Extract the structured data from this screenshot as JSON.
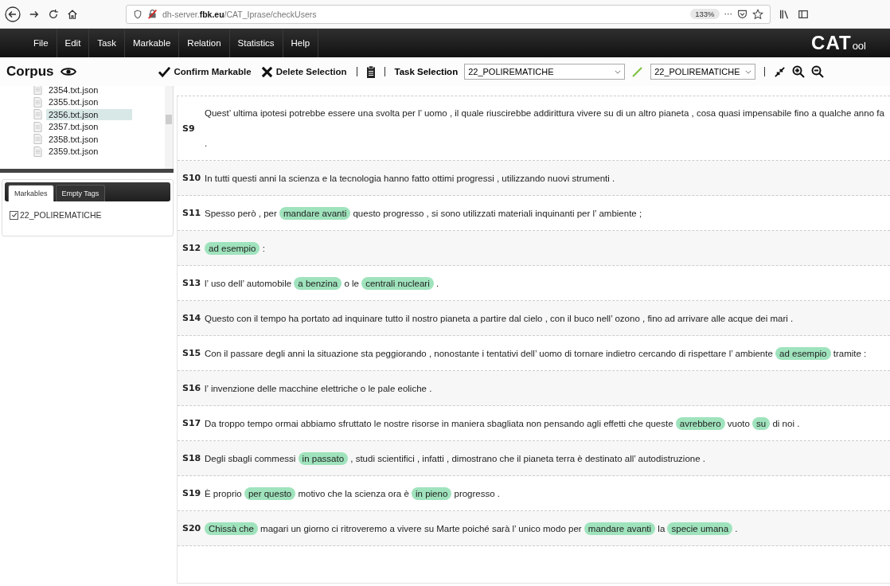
{
  "browser": {
    "url": "dh-server.**fbk.eu**/CAT_Iprase/checkUsers",
    "zoom": "133%",
    "more": "···"
  },
  "menu": [
    "File",
    "Edit",
    "Task",
    "Markable",
    "Relation",
    "Statistics",
    "Help"
  ],
  "logo": {
    "main": "CAT",
    "suffix": "ool"
  },
  "toolbar": {
    "corpus": "Corpus",
    "confirm": "Confirm Markable",
    "delete": "Delete Selection",
    "task_label": "Task Selection",
    "task_value": "22_POLIREMATICHE",
    "tag_value": "22_POLIREMATICHE"
  },
  "files": [
    {
      "name": "2354.txt.json",
      "selected": false
    },
    {
      "name": "2355.txt.json",
      "selected": false
    },
    {
      "name": "2356.txt.json",
      "selected": true
    },
    {
      "name": "2357.txt.json",
      "selected": false
    },
    {
      "name": "2358.txt.json",
      "selected": false
    },
    {
      "name": "2359.txt.json",
      "selected": false
    }
  ],
  "tabs": [
    {
      "label": "Markables",
      "selected": true
    },
    {
      "label": "Empty Tags",
      "selected": false
    }
  ],
  "markables": [
    {
      "label": "22_POLIREMATICHE",
      "checked": true
    }
  ],
  "sentences": [
    {
      "id": "S9",
      "segments": [
        {
          "text": "Quest’ ultima ipotesi potrebbe essere una svolta per l’ uomo , il quale riuscirebbe addirittura vivere su di un altro pianeta , cosa quasi impensabile fino a qualche anno fa .",
          "marked": false
        }
      ]
    },
    {
      "id": "S10",
      "segments": [
        {
          "text": "In tutti questi anni la scienza e la tecnologia hanno fatto ottimi progressi , utilizzando nuovi strumenti .",
          "marked": false
        }
      ]
    },
    {
      "id": "S11",
      "segments": [
        {
          "text": "Spesso però , per",
          "marked": false
        },
        {
          "text": "mandare avanti",
          "marked": true
        },
        {
          "text": "questo progresso , si sono utilizzati materiali inquinanti per l’ ambiente ;",
          "marked": false
        }
      ]
    },
    {
      "id": "S12",
      "segments": [
        {
          "text": "ad esempio",
          "marked": true
        },
        {
          "text": ":",
          "marked": false
        }
      ]
    },
    {
      "id": "S13",
      "segments": [
        {
          "text": "l’ uso dell’ automobile",
          "marked": false
        },
        {
          "text": "a benzina",
          "marked": true
        },
        {
          "text": "o le",
          "marked": false
        },
        {
          "text": "centrali nucleari",
          "marked": true
        },
        {
          "text": ".",
          "marked": false
        }
      ]
    },
    {
      "id": "S14",
      "segments": [
        {
          "text": "Questo con il tempo ha portato ad inquinare tutto il nostro pianeta a partire dal cielo , con il buco nell’ ozono , fino ad arrivare alle acque dei mari .",
          "marked": false
        }
      ]
    },
    {
      "id": "S15",
      "segments": [
        {
          "text": "Con il passare degli anni la situazione sta peggiorando , nonostante i tentativi dell’ uomo di tornare indietro cercando di rispettare l’ ambiente",
          "marked": false
        },
        {
          "text": "ad esempio",
          "marked": true
        },
        {
          "text": "tramite :",
          "marked": false
        }
      ]
    },
    {
      "id": "S16",
      "segments": [
        {
          "text": "l’ invenzione delle macchine elettriche o le pale eoliche .",
          "marked": false
        }
      ]
    },
    {
      "id": "S17",
      "segments": [
        {
          "text": "Da troppo tempo ormai abbiamo sfruttato le nostre risorse in maniera sbagliata non pensando agli effetti che queste",
          "marked": false
        },
        {
          "text": "avrebbero",
          "marked": true
        },
        {
          "text": "vuoto",
          "marked": false
        },
        {
          "text": "su",
          "marked": true
        },
        {
          "text": "di noi .",
          "marked": false
        }
      ]
    },
    {
      "id": "S18",
      "segments": [
        {
          "text": "Degli sbagli commessi",
          "marked": false
        },
        {
          "text": "in passato",
          "marked": true
        },
        {
          "text": ", studi scientifici , infatti , dimostrano che il pianeta terra è destinato all’ autodistruzione .",
          "marked": false
        }
      ]
    },
    {
      "id": "S19",
      "segments": [
        {
          "text": "È proprio",
          "marked": false
        },
        {
          "text": "per questo",
          "marked": true
        },
        {
          "text": "motivo che la scienza ora è",
          "marked": false
        },
        {
          "text": "in pieno",
          "marked": true
        },
        {
          "text": "progresso .",
          "marked": false
        }
      ]
    },
    {
      "id": "S20",
      "segments": [
        {
          "text": "Chissà che",
          "marked": true
        },
        {
          "text": "magari un giorno ci ritroveremo a vivere su Marte poiché sarà l’ unico modo per",
          "marked": false
        },
        {
          "text": "mandare avanti",
          "marked": true
        },
        {
          "text": "la",
          "marked": false
        },
        {
          "text": "specie umana",
          "marked": true
        },
        {
          "text": ".",
          "marked": false
        }
      ]
    }
  ]
}
